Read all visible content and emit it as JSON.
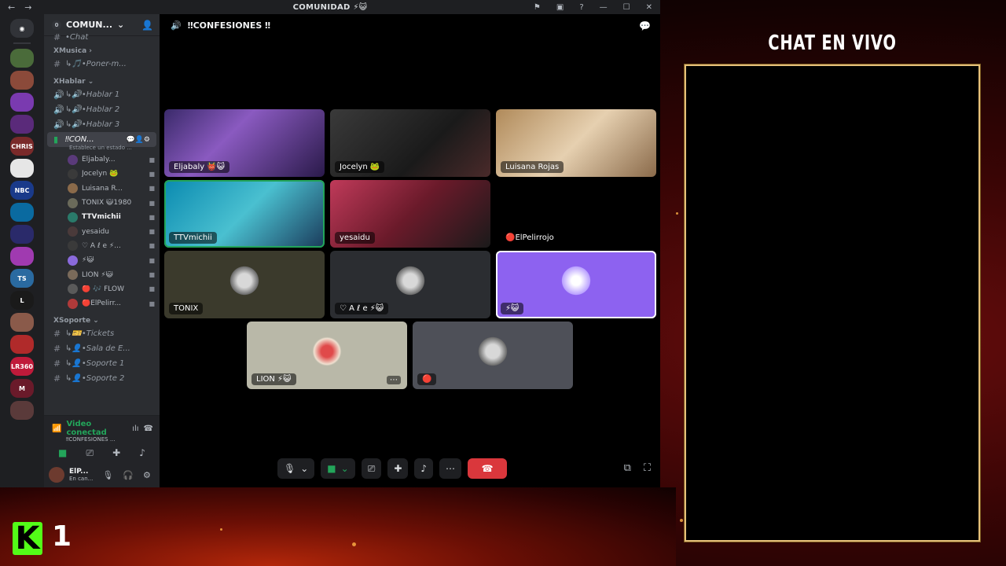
{
  "window": {
    "title": "COMUNIDAD ⚡😺",
    "controls": {
      "minimize": "—",
      "maximize": "☐",
      "close": "✕"
    }
  },
  "guilds": [
    {
      "label": "",
      "color": "#4a6b3a"
    },
    {
      "label": "",
      "color": "#8b4a3a"
    },
    {
      "label": "",
      "color": "#7a3ab0"
    },
    {
      "label": "",
      "color": "#5a2a7a"
    },
    {
      "label": "CHRIS",
      "color": "#7a2a2a"
    },
    {
      "label": "",
      "color": "#e6e6e6"
    },
    {
      "label": "NBC",
      "color": "#1a3a8a"
    },
    {
      "label": "",
      "color": "#0a6aa0"
    },
    {
      "label": "",
      "color": "#2a2a6a"
    },
    {
      "label": "",
      "color": "#a03ab0"
    },
    {
      "label": "TS",
      "color": "#2a6aa0"
    },
    {
      "label": "L",
      "color": "#1a1a1a"
    },
    {
      "label": "",
      "color": "#8a5a4a"
    },
    {
      "label": "",
      "color": "#b02a2a"
    },
    {
      "label": "LR360",
      "color": "#c01a3a"
    },
    {
      "label": "M",
      "color": "#6a1a2a"
    },
    {
      "label": "",
      "color": "#5a3a3a"
    }
  ],
  "server": {
    "name": "COMUN...",
    "badge": "0"
  },
  "channels": {
    "partial_top": "•Chat",
    "categories": [
      {
        "name": "XMusica ›",
        "items": [
          {
            "label": "↳🎵•Poner-m...",
            "type": "text"
          }
        ]
      },
      {
        "name": "XHablar ⌄",
        "items": [
          {
            "label": "↳🔊•Hablar 1",
            "type": "voice"
          },
          {
            "label": "↳🔊•Hablar 2",
            "type": "voice"
          },
          {
            "label": "↳🔊•Hablar 3",
            "type": "voice"
          }
        ]
      }
    ],
    "active": {
      "label": "‼CON...",
      "status": "Establece un estado ..."
    },
    "members": [
      {
        "name": "Eljabaly...",
        "color": "#5a3a7a",
        "bold": false
      },
      {
        "name": "Jocelyn 🐸",
        "color": "#3a3a3a",
        "bold": false
      },
      {
        "name": "Luisana R...",
        "color": "#8a6a4a",
        "bold": false
      },
      {
        "name": "TONIX 😺1980",
        "color": "#6a6a5a",
        "bold": false
      },
      {
        "name": "TTVmichii",
        "color": "#2a7a6a",
        "bold": true
      },
      {
        "name": "yesaidu",
        "color": "#4a3a3a",
        "bold": false
      },
      {
        "name": "♡ A ℓ e ⚡...",
        "color": "#3a3a3a",
        "bold": false
      },
      {
        "name": "⚡😺",
        "color": "#8a6adc",
        "bold": false
      },
      {
        "name": "LION ⚡😺",
        "color": "#7a6a5a",
        "bold": false
      },
      {
        "name": "🔴 🎶 FLOW",
        "color": "#5a5a5a",
        "bold": false
      },
      {
        "name": "🔴ElPelirr...",
        "color": "#b03a3a",
        "bold": false
      }
    ],
    "soporte": {
      "name": "XSoporte ⌄",
      "items": [
        {
          "label": "↳🎫•Tickets"
        },
        {
          "label": "↳👤•Sala de E..."
        },
        {
          "label": "↳👤•Soporte 1"
        },
        {
          "label": "↳👤•Soporte 2"
        }
      ]
    }
  },
  "voice_panel": {
    "status": "Video conectad",
    "channel": "‼CONFESIONES ..."
  },
  "user_panel": {
    "name": "ElP...",
    "status": "En can..."
  },
  "stage": {
    "channel_name": "‼CONFESIONES ‼",
    "tiles": [
      {
        "name": "Eljabaly 👹😺",
        "bg": "linear-gradient(135deg,#3a2a6a,#8a5ac0 40%,#2a1a4a)"
      },
      {
        "name": "Jocelyn 🐸",
        "bg": "linear-gradient(135deg,#3a3a3a,#1a1a1a 60%,#4a2a2a)"
      },
      {
        "name": "Luisana Rojas",
        "bg": "linear-gradient(135deg,#b08a5a,#e6d0b0 50%,#8a6a4a)"
      },
      {
        "name": "TTVmichii",
        "bg": "linear-gradient(135deg,#0a8ab0,#4ac0d0 50%,#1a3a5a)"
      },
      {
        "name": "yesaidu",
        "bg": "linear-gradient(135deg,#c03a5a,#6a1a2a 50%,#1a1a1a)"
      },
      {
        "name": "🔴ElPelirrojo",
        "bg": "#000"
      },
      {
        "name": "TONIX",
        "bg": "#3b3a2c"
      },
      {
        "name": "♡ A ℓ e ⚡😺",
        "bg": "#2b2d31"
      },
      {
        "name": "⚡😺",
        "bg": "#8d62f0"
      },
      {
        "name": "LION ⚡😺",
        "bg": "#b9b8a8"
      },
      {
        "name": "🔴",
        "bg": "#4e5058"
      }
    ]
  },
  "overlay": {
    "title": "CHAT EN VIVO",
    "kick_letter": "K",
    "kick_number": "1"
  }
}
